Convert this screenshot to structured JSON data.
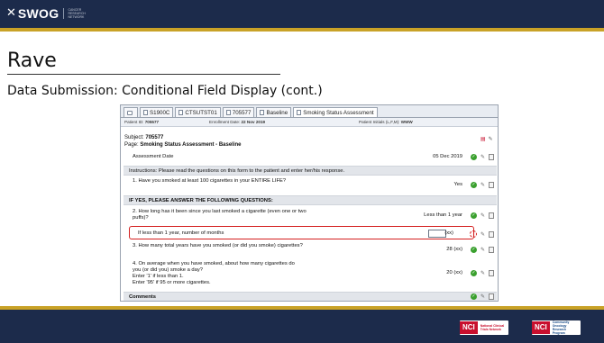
{
  "header": {
    "logo_text": "SWOG",
    "logo_tagline": "CANCER RESEARCH NETWORK",
    "slide_title": "Rave",
    "slide_subtitle": "Data Submission: Conditional Field Display (cont.)"
  },
  "footer": {
    "nci_left_badge": "NCI",
    "nci_left_text": "National Clinical Trials Network",
    "nci_right_badge": "NCI",
    "nci_right_text": "Community Oncology Research Program"
  },
  "tabs": [
    {
      "label": "S1900C",
      "icon": "folder-icon"
    },
    {
      "label": "CTSUTST01",
      "icon": "folder-icon"
    },
    {
      "label": "705577",
      "icon": "person-icon"
    },
    {
      "label": "Baseline",
      "icon": "folder-icon"
    },
    {
      "label": "Smoking Status Assessment",
      "icon": "page-icon",
      "active": true
    }
  ],
  "patient_bar": {
    "patient_id_label": "Patient ID:",
    "patient_id": "705577",
    "enrollment_label": "Enrollment Date:",
    "enrollment_date": "22 Nov 2019",
    "initials_label": "Patient Initials (L,F,M):",
    "initials": "WWW"
  },
  "form": {
    "subject_label": "Subject:",
    "subject": "705577",
    "page_label": "Page:",
    "page": "Smoking Status Assessment - Baseline",
    "rows": [
      {
        "label": "Assessment Date",
        "value": "05 Dec 2019"
      },
      {
        "label": "Instructions: Please read the questions on this form to the patient and enter her/his response."
      },
      {
        "label": "1. Have you smoked at least 100 cigarettes in your ENTIRE LIFE?",
        "value": "Yes"
      },
      {
        "label": "IF YES, PLEASE ANSWER THE FOLLOWING QUESTIONS:"
      },
      {
        "label": "2. How long has it been since you last smoked a cigarette (even one or two puffs)?",
        "value": "Less than 1 year"
      },
      {
        "label": "If less than 1 year, number of months",
        "unit": "(xx)"
      },
      {
        "label": "3. How many total years have you smoked (or did you smoke) cigarettes?",
        "value": "28  (xx)"
      },
      {
        "label": "4. On average when you have smoked, about how many cigarettes do you (or did you) smoke a day?",
        "extra1": "Enter '1' if less than 1.",
        "extra2": "Enter '95' if 95 or more cigarettes.",
        "value": "20  (xx)"
      },
      {
        "label": "Comments"
      }
    ]
  }
}
